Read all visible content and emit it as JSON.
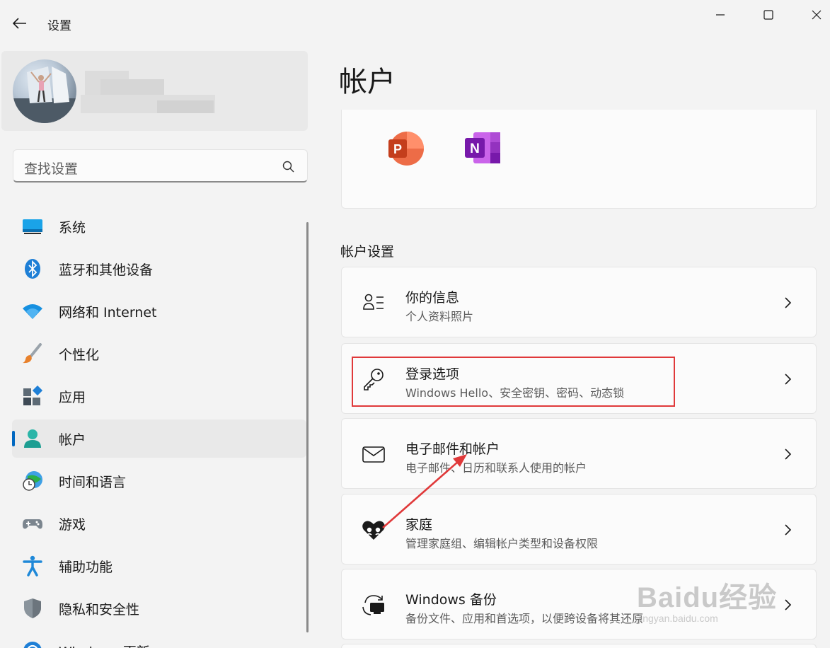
{
  "window": {
    "title": "设置",
    "buttons": {
      "minimize": "minimize-icon",
      "maximize": "maximize-icon",
      "close": "close-icon"
    }
  },
  "search": {
    "placeholder": "查找设置"
  },
  "nav": {
    "items": [
      {
        "label": "系统",
        "icon": "system-icon"
      },
      {
        "label": "蓝牙和其他设备",
        "icon": "bluetooth-icon"
      },
      {
        "label": "网络和 Internet",
        "icon": "wifi-icon"
      },
      {
        "label": "个性化",
        "icon": "brush-icon"
      },
      {
        "label": "应用",
        "icon": "apps-icon"
      },
      {
        "label": "帐户",
        "icon": "account-icon",
        "active": true
      },
      {
        "label": "时间和语言",
        "icon": "time-language-icon"
      },
      {
        "label": "游戏",
        "icon": "gamepad-icon"
      },
      {
        "label": "辅助功能",
        "icon": "accessibility-icon"
      },
      {
        "label": "隐私和安全性",
        "icon": "shield-icon"
      },
      {
        "label": "Windows 更新",
        "icon": "update-icon"
      }
    ]
  },
  "main": {
    "title": "帐户",
    "apps": [
      "PowerPoint",
      "OneNote"
    ],
    "section_title": "帐户设置",
    "settings": [
      {
        "title": "你的信息",
        "subtitle": "个人资料照片",
        "icon": "person-info-icon"
      },
      {
        "title": "登录选项",
        "subtitle": "Windows Hello、安全密钥、密码、动态锁",
        "icon": "key-icon",
        "highlighted": true
      },
      {
        "title": "电子邮件和帐户",
        "subtitle": "电子邮件、日历和联系人使用的帐户",
        "icon": "mail-icon"
      },
      {
        "title": "家庭",
        "subtitle": "管理家庭组、编辑帐户类型和设备权限",
        "icon": "family-heart-icon"
      },
      {
        "title": "Windows 备份",
        "subtitle": "备份文件、应用和首选项，以便跨设备将其还原",
        "icon": "backup-icon"
      }
    ]
  },
  "watermark": {
    "brand": "Baidu经验",
    "url": "jingyan.baidu.com"
  },
  "colors": {
    "accent": "#0067c0",
    "highlight": "#e0393a",
    "background": "#f3f3f3",
    "card": "#fbfbfb"
  }
}
